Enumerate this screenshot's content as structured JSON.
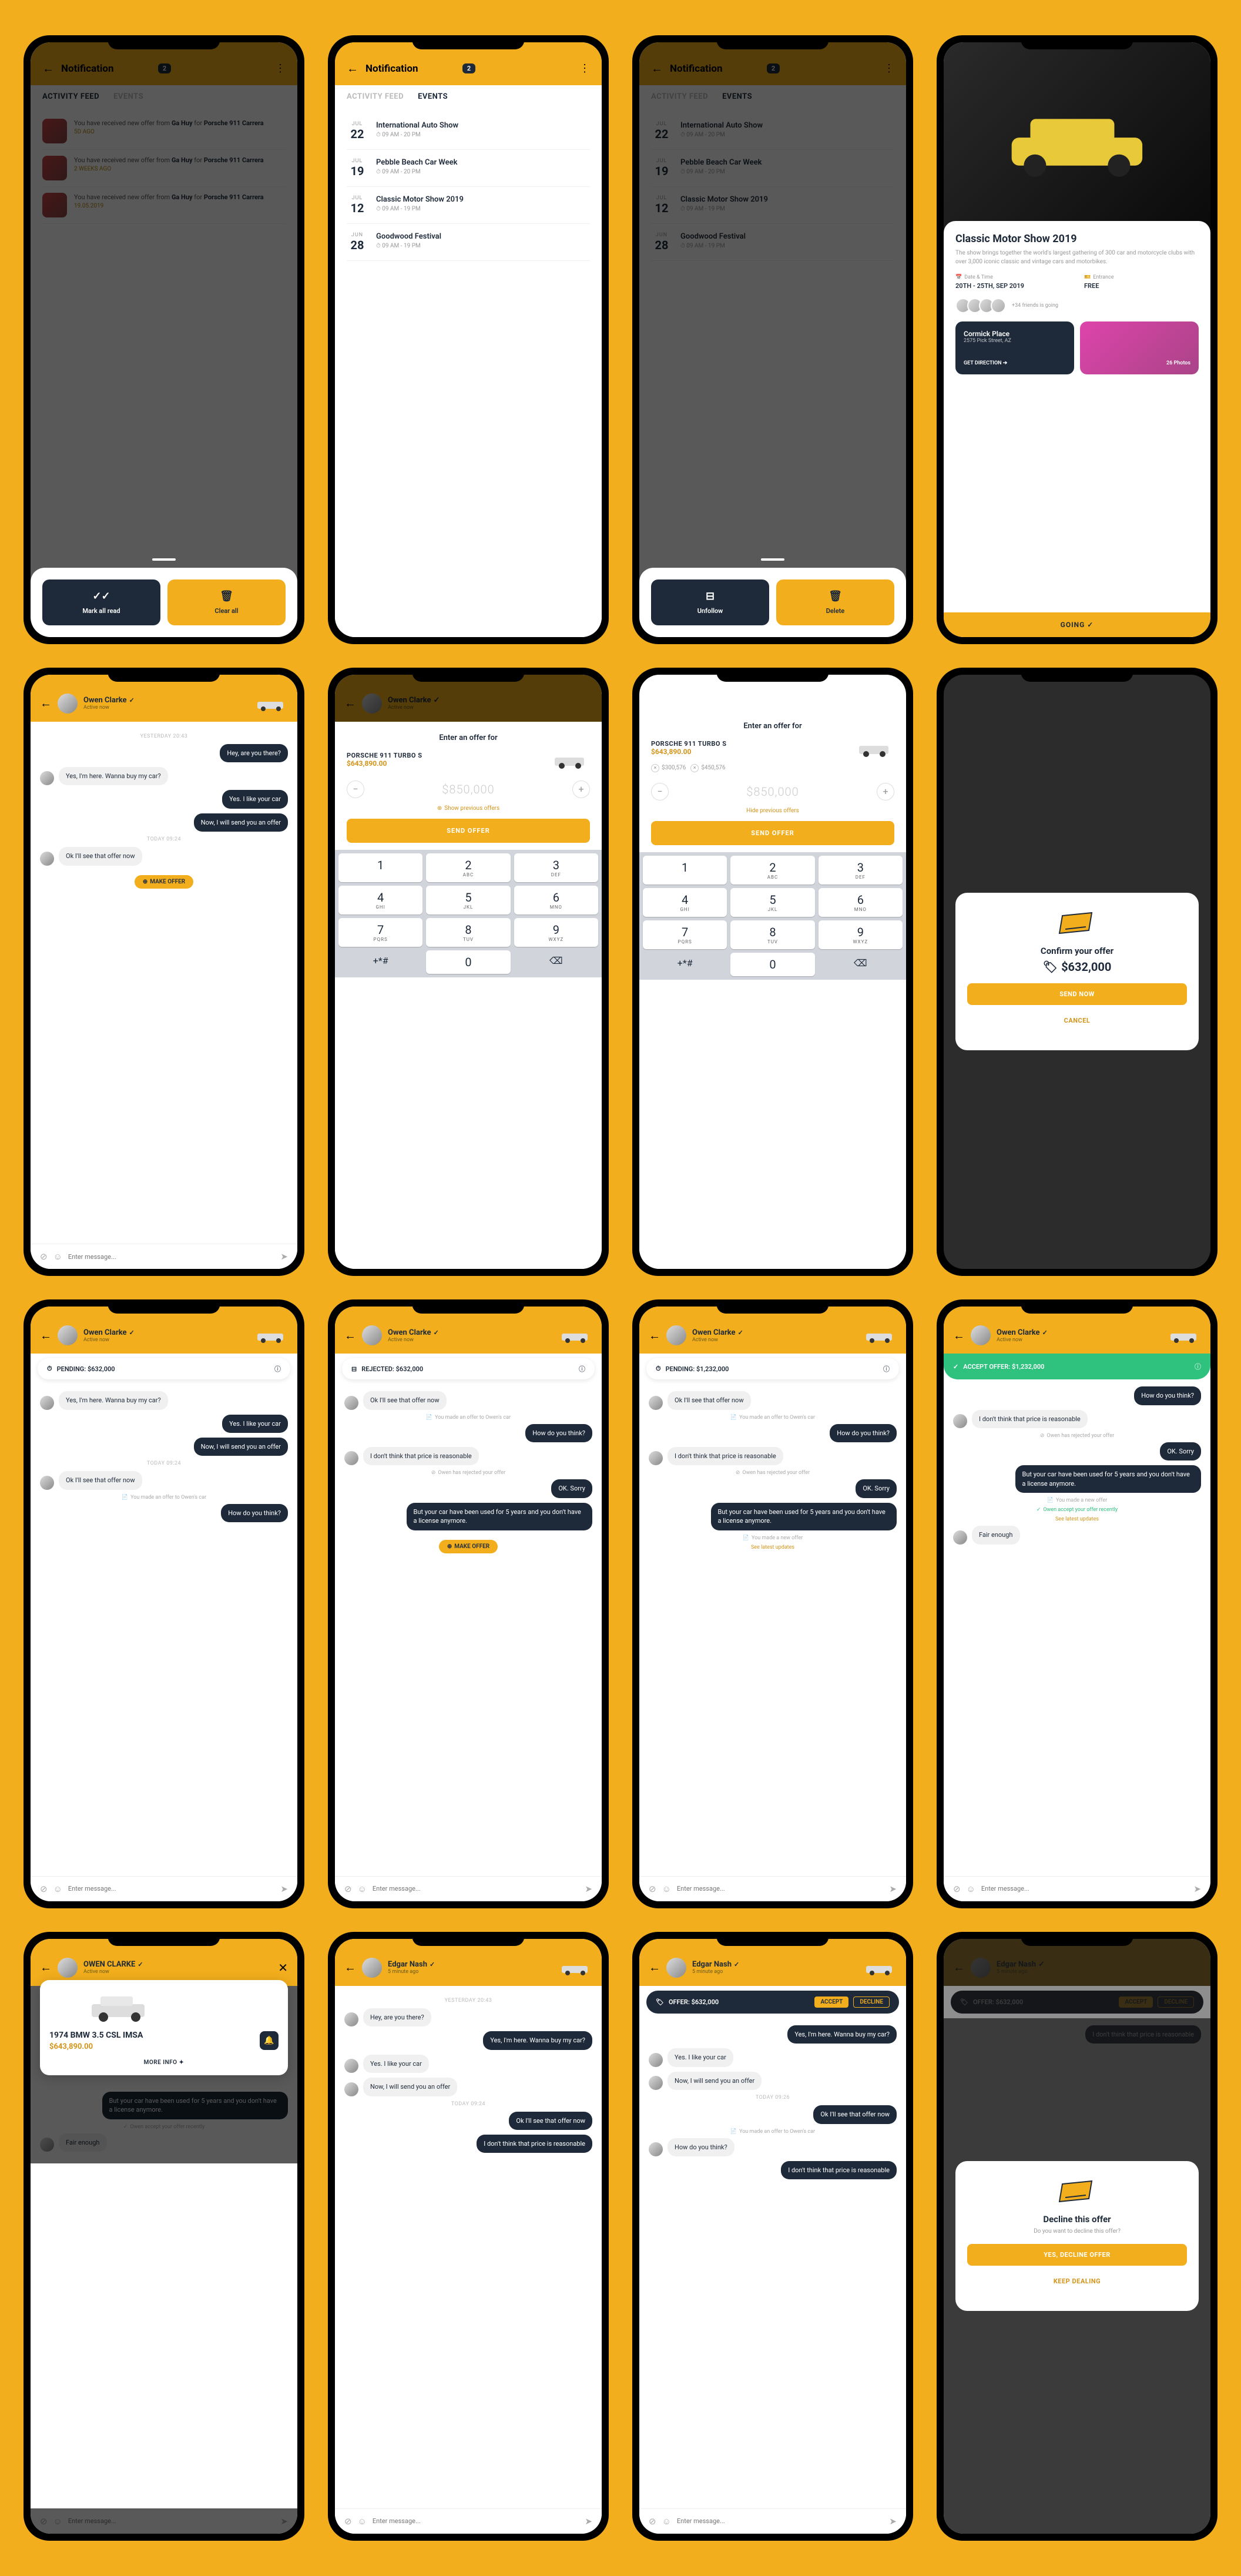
{
  "notification": {
    "title": "Notification",
    "badge": "2",
    "tabs": {
      "activity": "ACTIVITY FEED",
      "events": "EVENTS"
    },
    "feed_items": [
      {
        "text": "You have received new offer from",
        "who": "Ga Huy",
        "for": "for",
        "car": "Porsche 911 Carrera",
        "date": "5D AGO"
      },
      {
        "text": "You have received new offer from",
        "who": "Ga Huy",
        "for": "for",
        "car": "Porsche 911 Carrera",
        "date": "2 WEEKS AGO"
      },
      {
        "text": "You have received new offer from",
        "who": "Ga Huy",
        "for": "for",
        "car": "Porsche 911 Carrera",
        "date": "19.05.2019"
      }
    ],
    "events": [
      {
        "mon": "JUL",
        "day": "22",
        "title": "International Auto Show",
        "time": "09 AM - 20 PM"
      },
      {
        "mon": "JUL",
        "day": "19",
        "title": "Pebble Beach Car Week",
        "time": "09 AM - 20 PM"
      },
      {
        "mon": "JUL",
        "day": "12",
        "title": "Classic Motor Show 2019",
        "time": "09 AM - 19 PM"
      },
      {
        "mon": "JUN",
        "day": "28",
        "title": "Goodwood Festival",
        "time": "09 AM - 19 PM"
      }
    ],
    "actions": {
      "mark_read": "Mark all read",
      "clear": "Clear all",
      "unfollow": "Unfollow",
      "delete": "Delete"
    }
  },
  "event_detail": {
    "title": "Classic Motor Show 2019",
    "desc": "The show brings together the world's largest gathering of 300 car and motorcycle clubs with over 3,000 iconic classic and vintage cars and motorbikes.",
    "date_label": "Date & Time",
    "date_val": "20TH - 25TH, SEP 2019",
    "entrance_label": "Entrance",
    "entrance_val": "FREE",
    "friends": "+34 friends is going",
    "location_name": "Cormick Place",
    "location_addr": "2575 Pick Street, AZ",
    "get_direction": "GET DIRECTION ➔",
    "photos": "26 Photos",
    "going": "GOING ✓"
  },
  "chat": {
    "owen": {
      "name": "Owen Clarke",
      "name_caps": "OWEN CLARKE",
      "status": "Active now"
    },
    "edgar": {
      "name": "Edgar Nash",
      "status": "5 minute ago"
    },
    "timestamps": {
      "yesterday": "YESTERDAY 20:43",
      "today": "TODAY 09:24",
      "today26": "TODAY 09:26"
    },
    "msgs": {
      "hey": "Hey, are you there?",
      "here": "Yes, I'm here. Wanna buy my car?",
      "like": "Yes. I like your car",
      "send": "Now, I will send you an offer",
      "see": "Ok I'll see that offer now",
      "how": "How do you think?",
      "notreason": "I don't that price is reasonable",
      "notreason2": "I don't think that price is reasonable",
      "sorry": "OK. Sorry",
      "but": "But your car have been used for 5 years and you don't  have a license anymore.",
      "fair": "Fair enough"
    },
    "sys": {
      "made_offer": "You made an offer to Owen's car",
      "rejected": "Owen has rejected your offer",
      "new_offer": "You made a new offer",
      "accepted": "Owen accept your offer recently",
      "latest": "See latest updates"
    },
    "make_offer": "MAKE OFFER",
    "composer_placeholder": "Enter message..."
  },
  "offers": {
    "pending": "PENDING: $632,000",
    "rejected": "REJECTED: $632,000",
    "pending2": "PENDING: $1,232,000",
    "accept": "ACCEPT OFFER: $1,232,000",
    "offer_bar": "OFFER: $632,000",
    "accept_btn": "ACCEPT",
    "decline_btn": "DECLINE"
  },
  "offer_entry": {
    "title": "Enter an offer for",
    "car": "PORSCHE 911 TURBO S",
    "price": "$643,890.00",
    "chips": [
      "$300,576",
      "$450,576"
    ],
    "placeholder": "$850,000",
    "show_prev": "Show previous offers",
    "hide_prev": "Hide previous offers",
    "send": "SEND OFFER"
  },
  "keypad": [
    {
      "n": "1",
      "s": ""
    },
    {
      "n": "2",
      "s": "ABC"
    },
    {
      "n": "3",
      "s": "DEF"
    },
    {
      "n": "4",
      "s": "GHI"
    },
    {
      "n": "5",
      "s": "JKL"
    },
    {
      "n": "6",
      "s": "MNO"
    },
    {
      "n": "7",
      "s": "PQRS"
    },
    {
      "n": "8",
      "s": "TUV"
    },
    {
      "n": "9",
      "s": "WXYZ"
    },
    {
      "n": "+*#",
      "s": ""
    },
    {
      "n": "0",
      "s": ""
    },
    {
      "n": "⌫",
      "s": ""
    }
  ],
  "confirm": {
    "title": "Confirm your offer",
    "price": "$632,000",
    "send": "SEND NOW",
    "cancel": "CANCEL"
  },
  "decline": {
    "title": "Decline this offer",
    "sub": "Do you want to decline this offer?",
    "yes": "YES, DECLINE OFFER",
    "keep": "KEEP DEALING"
  },
  "car_card": {
    "name": "1974 BMW 3.5 CSL IMSA",
    "price": "$643,890.00",
    "more": "MORE INFO ✦"
  }
}
